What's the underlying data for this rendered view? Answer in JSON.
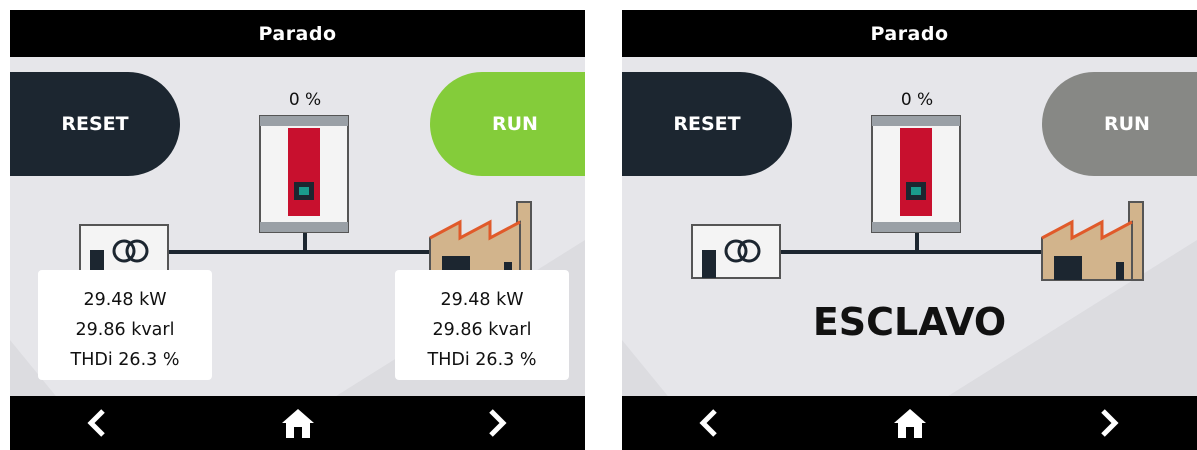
{
  "screens": [
    {
      "status_title": "Parado",
      "reset_label": "RESET",
      "run_label": "RUN",
      "run_state": "active",
      "run_color": "#84cc3a",
      "load_percent": "0 %",
      "grid_readings": [
        "29.48 kW",
        "29.86 kvarl",
        "THDi 26.3 %"
      ],
      "load_readings": [
        "29.48 kW",
        "29.86 kvarl",
        "THDi 26.3 %"
      ]
    },
    {
      "status_title": "Parado",
      "reset_label": "RESET",
      "run_label": "RUN",
      "run_state": "disabled",
      "run_color": "#878885",
      "load_percent": "0 %",
      "mode_label": "ESCLAVO"
    }
  ],
  "icons": {
    "prev": "chevron-left-icon",
    "home": "home-icon",
    "next": "chevron-right-icon",
    "equipment": "compensator-cabinet-icon",
    "grid": "transformer-icon",
    "load": "factory-icon"
  },
  "colors": {
    "reset_button": "#1c2630",
    "cabinet_accent": "#c8102e",
    "indicator": "#1a9a8c"
  }
}
